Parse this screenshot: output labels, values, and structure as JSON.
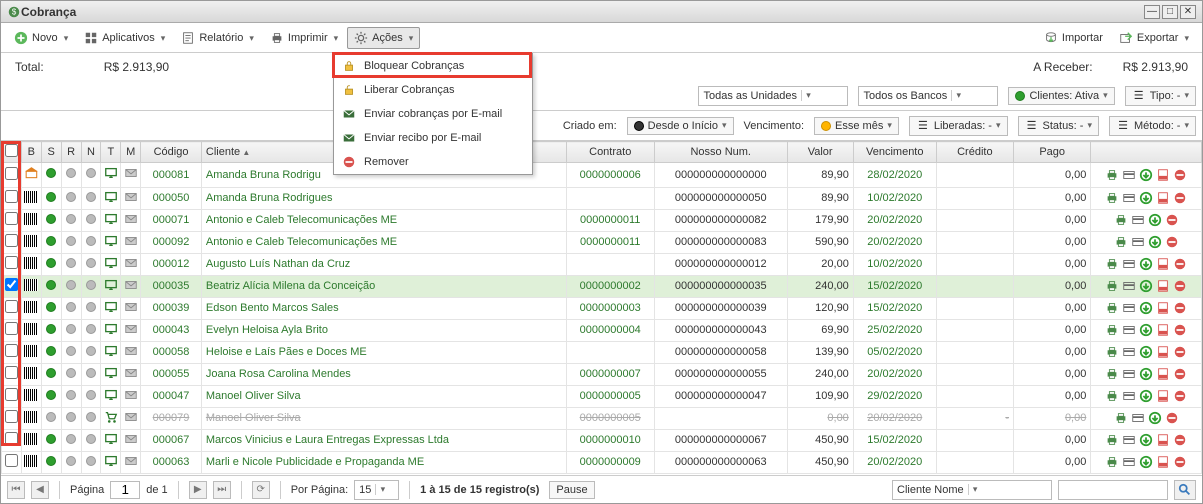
{
  "window": {
    "title": "Cobrança"
  },
  "toolbar": {
    "novo": "Novo",
    "aplicativos": "Aplicativos",
    "relatorio": "Relatório",
    "imprimir": "Imprimir",
    "acoes": "Ações",
    "importar": "Importar",
    "exportar": "Exportar"
  },
  "menu": {
    "bloquear": "Bloquear Cobranças",
    "liberar": "Liberar Cobranças",
    "enviar_cobrancas": "Enviar cobranças por E-mail",
    "enviar_recibo": "Enviar recibo por E-mail",
    "remover": "Remover"
  },
  "summary": {
    "total_label": "Total:",
    "total_value": "R$ 2.913,90",
    "receber_label": "A Receber:",
    "receber_value": "R$ 2.913,90"
  },
  "filters": {
    "unidades": "Todas as Unidades",
    "bancos": "Todos os Bancos",
    "clientes_ativa": "Clientes: Ativa",
    "tipo": "Tipo: -",
    "criado_em": "Criado em:",
    "desde_inicio": "Desde o Início",
    "vencimento_label": "Vencimento:",
    "esse_mes": "Esse mês",
    "liberadas": "Liberadas: -",
    "status": "Status: -",
    "metodo": "Método: -"
  },
  "headers": {
    "b": "B",
    "s": "S",
    "r": "R",
    "n": "N",
    "t": "T",
    "m": "M",
    "codigo": "Código",
    "cliente": "Cliente",
    "contrato": "Contrato",
    "nosso_num": "Nosso Num.",
    "valor": "Valor",
    "venc": "Vencimento",
    "credito": "Crédito",
    "pago": "Pago"
  },
  "rows": [
    {
      "checked": false,
      "codigo": "000081",
      "cliente": "Amanda Bruna Rodrigu",
      "contrato": "0000000006",
      "nosso": "000000000000000",
      "valor": "89,90",
      "venc": "28/02/2020",
      "credito": "",
      "pago": "0,00",
      "strike": false,
      "special_b": true,
      "pdf": true
    },
    {
      "checked": false,
      "codigo": "000050",
      "cliente": "Amanda Bruna Rodrigues",
      "contrato": "",
      "nosso": "000000000000050",
      "valor": "89,90",
      "venc": "10/02/2020",
      "credito": "",
      "pago": "0,00",
      "strike": false,
      "pdf": true
    },
    {
      "checked": false,
      "codigo": "000071",
      "cliente": "Antonio e Caleb Telecomunicações ME",
      "contrato": "0000000011",
      "nosso": "000000000000082",
      "valor": "179,90",
      "venc": "20/02/2020",
      "credito": "",
      "pago": "0,00",
      "strike": false,
      "pdf": false
    },
    {
      "checked": false,
      "codigo": "000092",
      "cliente": "Antonio e Caleb Telecomunicações ME",
      "contrato": "0000000011",
      "nosso": "000000000000083",
      "valor": "590,90",
      "venc": "20/02/2020",
      "credito": "",
      "pago": "0,00",
      "strike": false,
      "pdf": false
    },
    {
      "checked": false,
      "codigo": "000012",
      "cliente": "Augusto Luís Nathan da Cruz",
      "contrato": "",
      "nosso": "000000000000012",
      "valor": "20,00",
      "venc": "10/02/2020",
      "credito": "",
      "pago": "0,00",
      "strike": false,
      "pdf": true
    },
    {
      "checked": true,
      "codigo": "000035",
      "cliente": "Beatriz Alícia Milena da Conceição",
      "contrato": "0000000002",
      "nosso": "000000000000035",
      "valor": "240,00",
      "venc": "15/02/2020",
      "credito": "",
      "pago": "0,00",
      "strike": false,
      "pdf": true
    },
    {
      "checked": false,
      "codigo": "000039",
      "cliente": "Edson Bento Marcos Sales",
      "contrato": "0000000003",
      "nosso": "000000000000039",
      "valor": "120,90",
      "venc": "15/02/2020",
      "credito": "",
      "pago": "0,00",
      "strike": false,
      "pdf": true
    },
    {
      "checked": false,
      "codigo": "000043",
      "cliente": "Evelyn Heloisa Ayla Brito",
      "contrato": "0000000004",
      "nosso": "000000000000043",
      "valor": "69,90",
      "venc": "25/02/2020",
      "credito": "",
      "pago": "0,00",
      "strike": false,
      "pdf": true
    },
    {
      "checked": false,
      "codigo": "000058",
      "cliente": "Heloise e Laís Pães e Doces ME",
      "contrato": "",
      "nosso": "000000000000058",
      "valor": "139,90",
      "venc": "05/02/2020",
      "credito": "",
      "pago": "0,00",
      "strike": false,
      "pdf": true
    },
    {
      "checked": false,
      "codigo": "000055",
      "cliente": "Joana Rosa Carolina Mendes",
      "contrato": "0000000007",
      "nosso": "000000000000055",
      "valor": "240,00",
      "venc": "20/02/2020",
      "credito": "",
      "pago": "0,00",
      "strike": false,
      "pdf": true
    },
    {
      "checked": false,
      "codigo": "000047",
      "cliente": "Manoel Oliver Silva",
      "contrato": "0000000005",
      "nosso": "000000000000047",
      "valor": "109,90",
      "venc": "29/02/2020",
      "credito": "",
      "pago": "0,00",
      "strike": false,
      "pdf": true
    },
    {
      "checked": false,
      "codigo": "000079",
      "cliente": "Manoel Oliver Silva",
      "contrato": "0000000005",
      "nosso": "",
      "valor": "0,00",
      "venc": "20/02/2020",
      "credito": "-",
      "pago": "0,00",
      "strike": true,
      "cart": true,
      "pdf": false
    },
    {
      "checked": false,
      "codigo": "000067",
      "cliente": "Marcos Vinicius e Laura Entregas Expressas Ltda",
      "contrato": "0000000010",
      "nosso": "000000000000067",
      "valor": "450,90",
      "venc": "15/02/2020",
      "credito": "",
      "pago": "0,00",
      "strike": false,
      "pdf": true
    },
    {
      "checked": false,
      "codigo": "000063",
      "cliente": "Marli e Nicole Publicidade e Propaganda ME",
      "contrato": "0000000009",
      "nosso": "000000000000063",
      "valor": "450,90",
      "venc": "20/02/2020",
      "credito": "",
      "pago": "0,00",
      "strike": false,
      "pdf": true
    }
  ],
  "footer": {
    "pagina": "Página",
    "page_val": "1",
    "de": "de 1",
    "por_pagina": "Por Página:",
    "per_page_val": "15",
    "registros": "1 à 15 de 15 registro(s)",
    "pause": "Pause",
    "search_combo": "Cliente Nome"
  }
}
